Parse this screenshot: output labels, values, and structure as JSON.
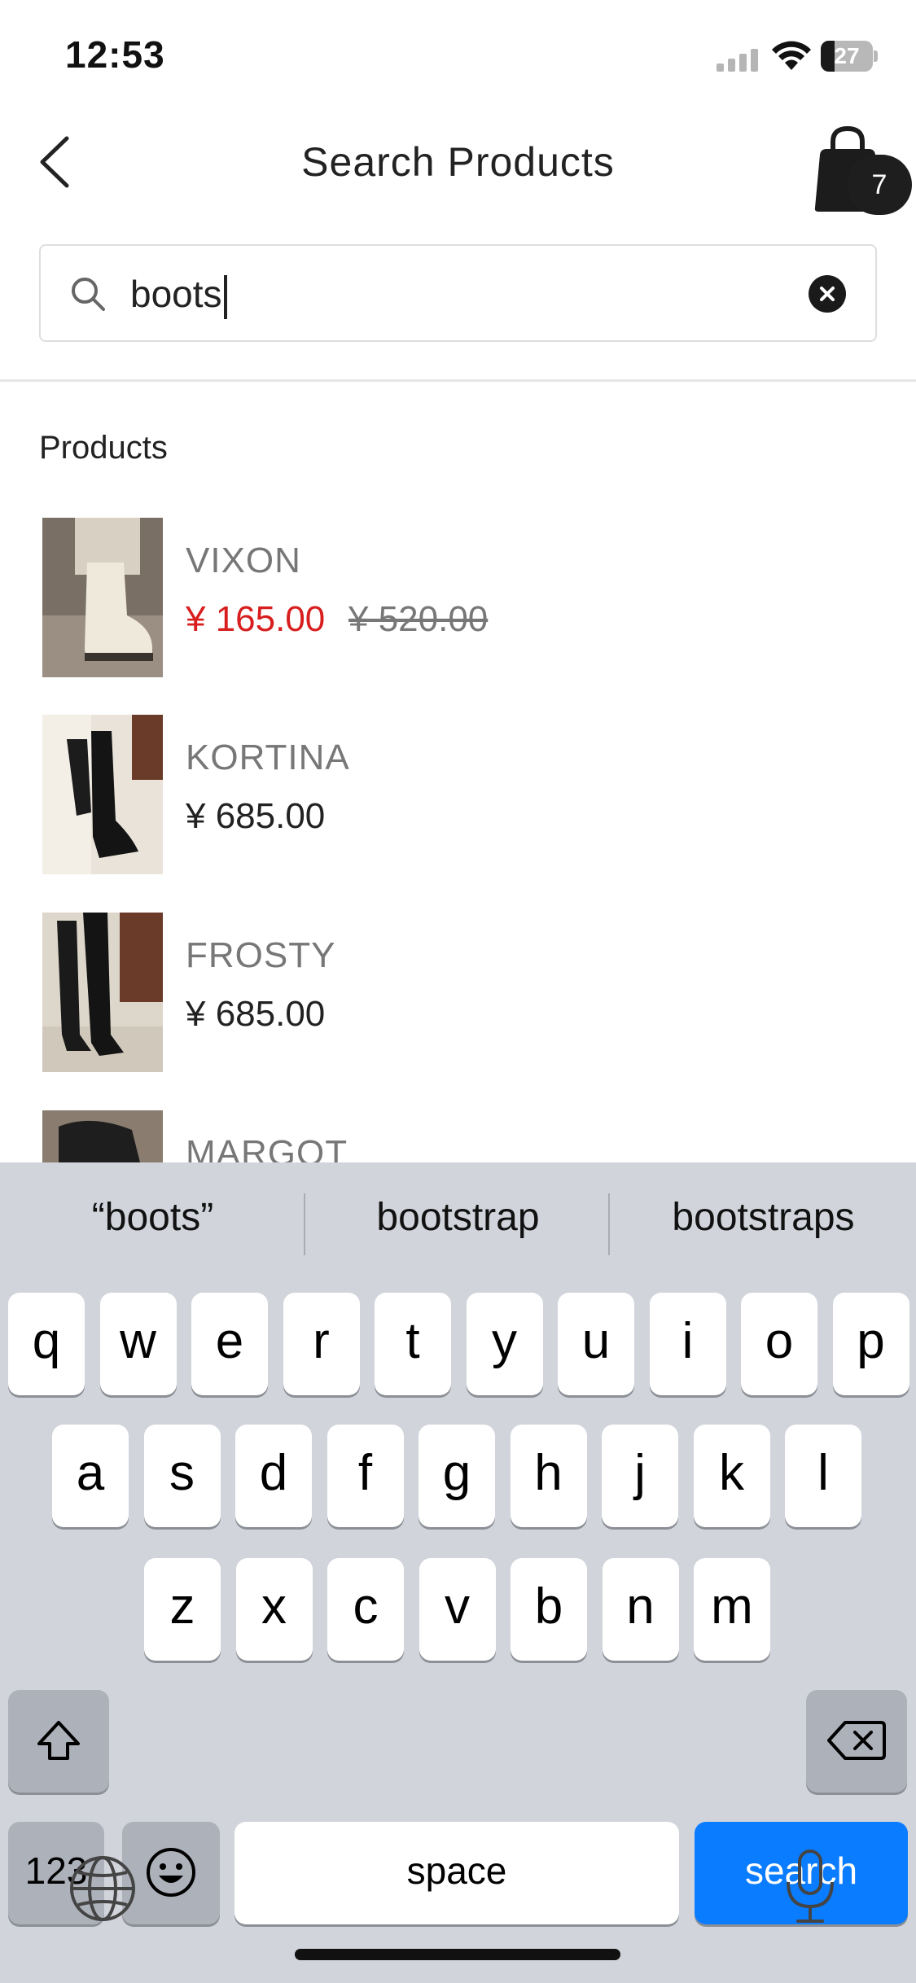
{
  "status_bar": {
    "time": "12:53",
    "battery": "27",
    "battery_level": 0.27
  },
  "header": {
    "title": "Search Products",
    "cart_count": "7"
  },
  "search": {
    "value": "boots",
    "placeholder": ""
  },
  "products_section": {
    "title": "Products",
    "items": [
      {
        "name": "VIXON",
        "price": "¥ 165.00",
        "original_price": "¥ 520.00",
        "on_sale": true
      },
      {
        "name": "KORTINA",
        "price": "¥ 685.00"
      },
      {
        "name": "FROSTY",
        "price": "¥ 685.00"
      },
      {
        "name": "MARGOT"
      }
    ]
  },
  "keyboard": {
    "suggestions": [
      "“boots”",
      "bootstrap",
      "bootstraps"
    ],
    "row1": [
      "q",
      "w",
      "e",
      "r",
      "t",
      "y",
      "u",
      "i",
      "o",
      "p"
    ],
    "row2": [
      "a",
      "s",
      "d",
      "f",
      "g",
      "h",
      "j",
      "k",
      "l"
    ],
    "row3": [
      "z",
      "x",
      "c",
      "v",
      "b",
      "n",
      "m"
    ],
    "numbers_label": "123",
    "space_label": "space",
    "action_label": "search"
  },
  "colors": {
    "sale_price": "#d81e1e",
    "search_key": "#0a7cff",
    "keyboard_bg": "#d1d4db"
  }
}
